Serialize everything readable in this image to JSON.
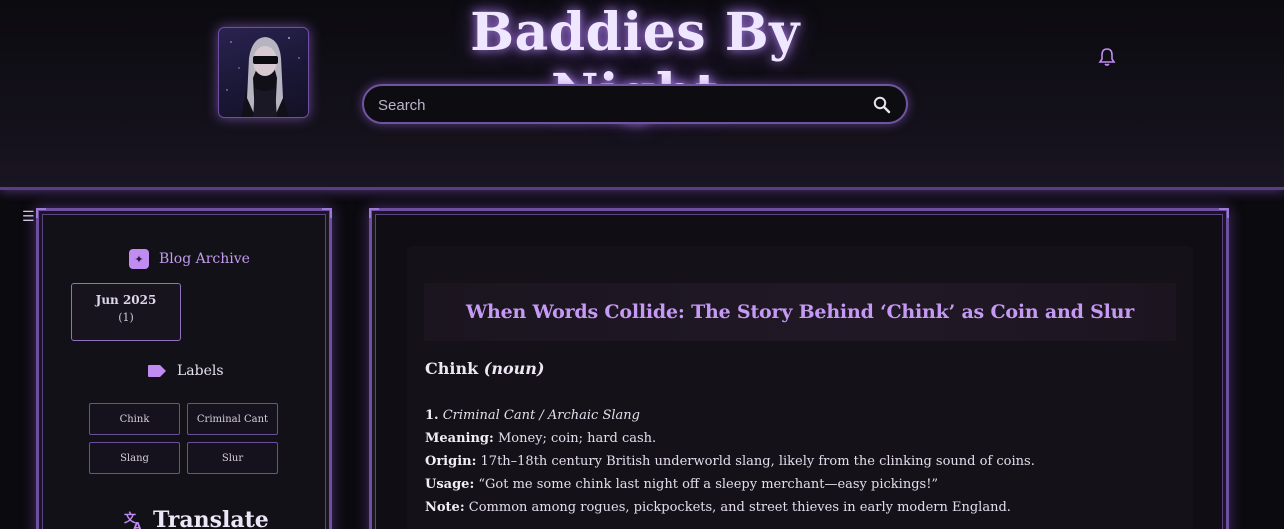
{
  "header": {
    "site_title": "Baddies By Night",
    "search_placeholder": "Search"
  },
  "sidebar": {
    "menu_icon": "☰",
    "archive": {
      "title": "Blog Archive",
      "month": "Jun 2025",
      "count": "(1)"
    },
    "labels": {
      "title": "Labels",
      "items": [
        "Chink",
        "Criminal Cant",
        "Slang",
        "Slur"
      ]
    },
    "translate": {
      "title": "Translate"
    }
  },
  "post": {
    "title": "When Words Collide: The Story Behind ‘Chink’ as Coin and Slur",
    "term": "Chink",
    "part_of_speech": "(noun)",
    "sense_number": "1.",
    "sense_label": "Criminal Cant / Archaic Slang",
    "fields": [
      {
        "label": "Meaning:",
        "text": " Money; coin; hard cash."
      },
      {
        "label": "Origin:",
        "text": " 17th–18th century British underworld slang, likely from the clinking sound of coins."
      },
      {
        "label": "Usage:",
        "text": " “Got me some chink last night off a sleepy merchant—easy pickings!”"
      },
      {
        "label": "Note:",
        "text": " Common among rogues, pickpockets, and street thieves in early modern England."
      }
    ]
  },
  "icons": {
    "bell": "bell-icon",
    "search": "search-icon",
    "archive": "archive-icon",
    "label": "label-tag-icon",
    "translate": "translate-icon",
    "menu": "hamburger-menu-icon"
  },
  "colors": {
    "accent": "#c59af4",
    "border": "#6e4fa0",
    "background": "#0b0a0e"
  }
}
